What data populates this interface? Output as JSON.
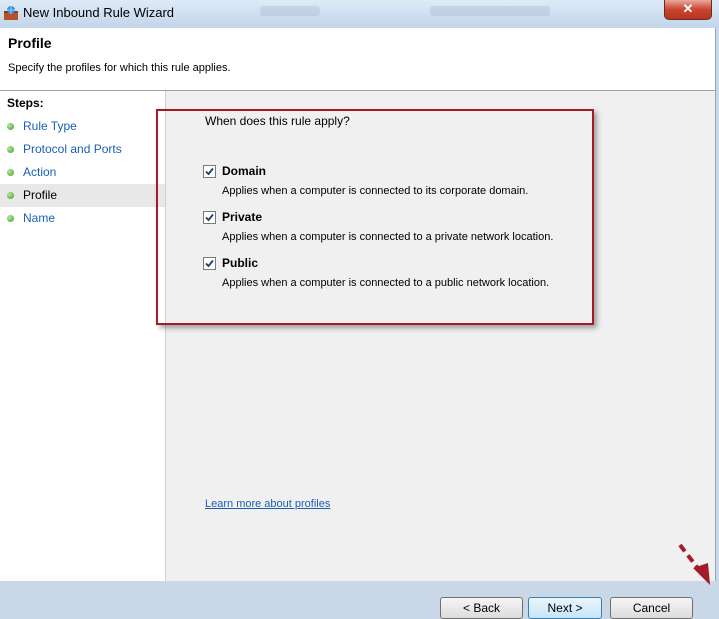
{
  "window": {
    "title": "New Inbound Rule Wizard",
    "close_label": "✕"
  },
  "header": {
    "title": "Profile",
    "subtitle": "Specify the profiles for which this rule applies."
  },
  "steps": {
    "title": "Steps:",
    "items": [
      {
        "label": "Rule Type",
        "current": false
      },
      {
        "label": "Protocol and Ports",
        "current": false
      },
      {
        "label": "Action",
        "current": false
      },
      {
        "label": "Profile",
        "current": true
      },
      {
        "label": "Name",
        "current": false
      }
    ]
  },
  "content": {
    "question": "When does this rule apply?",
    "options": [
      {
        "label": "Domain",
        "checked": true,
        "description": "Applies when a computer is connected to its corporate domain."
      },
      {
        "label": "Private",
        "checked": true,
        "description": "Applies when a computer is connected to a private network location."
      },
      {
        "label": "Public",
        "checked": true,
        "description": "Applies when a computer is connected to a public network location."
      }
    ],
    "learn_more": "Learn more about profiles"
  },
  "buttons": {
    "back": "< Back",
    "next": "Next >",
    "cancel": "Cancel"
  },
  "colors": {
    "highlight": "#a31b26",
    "link": "#1a5fb4",
    "step_dot": "#3a9e24"
  }
}
